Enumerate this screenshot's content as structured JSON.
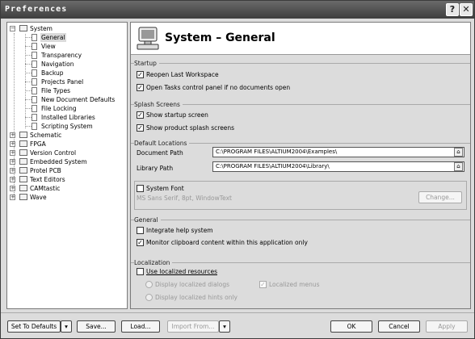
{
  "window": {
    "title": "Preferences",
    "help_label": "?",
    "close_label": "✕"
  },
  "tree": {
    "items": [
      {
        "label": "System",
        "expander": "−"
      },
      {
        "label": "General"
      },
      {
        "label": "View"
      },
      {
        "label": "Transparency"
      },
      {
        "label": "Navigation"
      },
      {
        "label": "Backup"
      },
      {
        "label": "Projects Panel"
      },
      {
        "label": "File Types"
      },
      {
        "label": "New Document Defaults"
      },
      {
        "label": "File Locking"
      },
      {
        "label": "Installed Libraries"
      },
      {
        "label": "Scripting System"
      },
      {
        "label": "Schematic",
        "expander": "+"
      },
      {
        "label": "FPGA",
        "expander": "+"
      },
      {
        "label": "Version Control",
        "expander": "+"
      },
      {
        "label": "Embedded System",
        "expander": "+"
      },
      {
        "label": "Protel PCB",
        "expander": "+"
      },
      {
        "label": "Text Editors",
        "expander": "+"
      },
      {
        "label": "CAMtastic",
        "expander": "+"
      },
      {
        "label": "Wave",
        "expander": "+"
      }
    ],
    "selected": "General"
  },
  "header": {
    "title": "System – General"
  },
  "startup": {
    "label": "Startup",
    "reopen": {
      "label": "Reopen Last Workspace",
      "checked": true
    },
    "open_tasks": {
      "label": "Open Tasks control panel if no documents open",
      "checked": true
    }
  },
  "splash": {
    "label": "Splash Screens",
    "startup_screen": {
      "label": "Show startup screen",
      "checked": true
    },
    "product_screens": {
      "label": "Show product splash screens",
      "checked": true
    }
  },
  "locations": {
    "label": "Default Locations",
    "document_path": {
      "label": "Document Path",
      "value": "C:\\PROGRAM FILES\\ALTIUM2004\\Examples\\"
    },
    "library_path": {
      "label": "Library Path",
      "value": "C:\\PROGRAM FILES\\ALTIUM2004\\Library\\"
    }
  },
  "system_font": {
    "label": "System Font",
    "checked": false,
    "description": "MS Sans Serif, 8pt, WindowText",
    "change_label": "Change..."
  },
  "general": {
    "label": "General",
    "integrate_help": {
      "label": "Integrate help system",
      "checked": false
    },
    "monitor_clipboard": {
      "label": "Monitor clipboard content within this application only",
      "checked": true
    }
  },
  "localization": {
    "label": "Localization",
    "use_localized": {
      "label": "Use localized resources",
      "checked": false
    },
    "display_dialogs": {
      "label": "Display localized dialogs"
    },
    "localized_menus": {
      "label": "Localized menus",
      "checked": true
    },
    "display_hints": {
      "label": "Display localized hints only"
    }
  },
  "footer": {
    "set_defaults": "Set To Defaults",
    "save": "Save...",
    "load": "Load...",
    "import_from": "Import From...",
    "ok": "OK",
    "cancel": "Cancel",
    "apply": "Apply"
  }
}
